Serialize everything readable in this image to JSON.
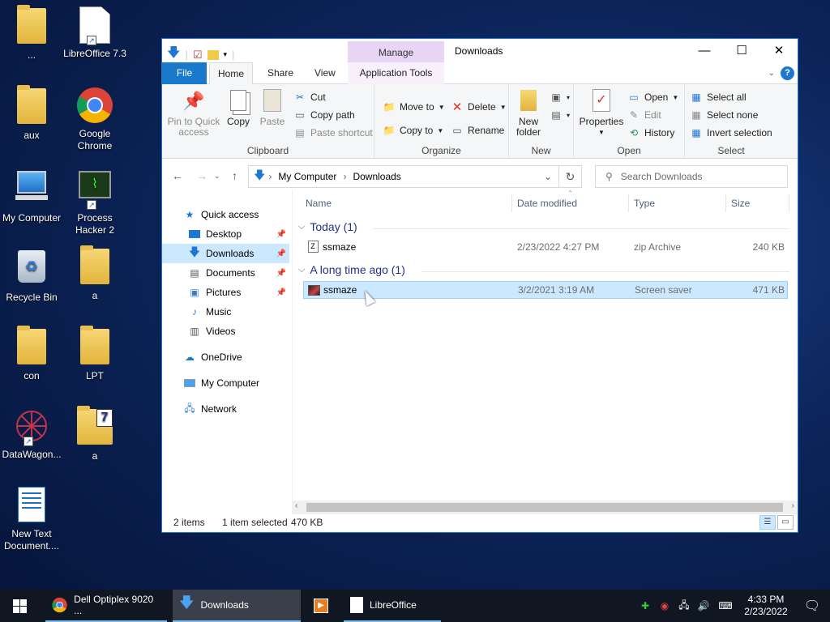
{
  "desktop": {
    "icons": [
      {
        "label": "...",
        "icon": "folder-icon"
      },
      {
        "label": "LibreOffice 7.3",
        "icon": "libreoffice-icon"
      },
      {
        "label": "aux",
        "icon": "folder-icon"
      },
      {
        "label": "Google Chrome",
        "icon": "chrome-icon"
      },
      {
        "label": "My Computer",
        "icon": "computer-icon"
      },
      {
        "label": "Process Hacker 2",
        "icon": "process-hacker-icon"
      },
      {
        "label": "Recycle Bin",
        "icon": "recycle-bin-icon"
      },
      {
        "label": "a",
        "icon": "folder-icon"
      },
      {
        "label": "con",
        "icon": "folder-icon"
      },
      {
        "label": "LPT",
        "icon": "folder-icon"
      },
      {
        "label": "DataWagon...",
        "icon": "datawagon-icon"
      },
      {
        "label": "a",
        "icon": "zip-folder-icon"
      },
      {
        "label": "New Text Document....",
        "icon": "text-document-icon"
      }
    ]
  },
  "window": {
    "title": "Downloads",
    "contextual_tab": "Manage",
    "tabs": {
      "file": "File",
      "home": "Home",
      "share": "Share",
      "view": "View",
      "app_tools": "Application Tools"
    },
    "controls": {
      "minimize": "—",
      "maximize": "☐",
      "close": "✕"
    }
  },
  "ribbon": {
    "clipboard": {
      "label": "Clipboard",
      "pin": "Pin to Quick access",
      "copy": "Copy",
      "paste": "Paste",
      "cut": "Cut",
      "copy_path": "Copy path",
      "paste_shortcut": "Paste shortcut"
    },
    "organize": {
      "label": "Organize",
      "move_to": "Move to",
      "copy_to": "Copy to",
      "delete": "Delete",
      "rename": "Rename"
    },
    "new": {
      "label": "New",
      "new_folder": "New folder"
    },
    "open": {
      "label": "Open",
      "properties": "Properties",
      "open": "Open",
      "edit": "Edit",
      "history": "History"
    },
    "select": {
      "label": "Select",
      "select_all": "Select all",
      "select_none": "Select none",
      "invert": "Invert selection"
    }
  },
  "address": {
    "crumbs": [
      "My Computer",
      "Downloads"
    ],
    "search_placeholder": "Search Downloads"
  },
  "nav": {
    "quick_access": "Quick access",
    "desktop": "Desktop",
    "downloads": "Downloads",
    "documents": "Documents",
    "pictures": "Pictures",
    "music": "Music",
    "videos": "Videos",
    "onedrive": "OneDrive",
    "my_computer": "My Computer",
    "network": "Network"
  },
  "columns": {
    "name": "Name",
    "date": "Date modified",
    "type": "Type",
    "size": "Size"
  },
  "groups": [
    {
      "title": "Today (1)",
      "files": [
        {
          "name": "ssmaze",
          "date": "2/23/2022 4:27 PM",
          "type": "zip Archive",
          "size": "240 KB"
        }
      ]
    },
    {
      "title": "A long time ago (1)",
      "files": [
        {
          "name": "ssmaze",
          "date": "3/2/2021 3:19 AM",
          "type": "Screen saver",
          "size": "471 KB"
        }
      ]
    }
  ],
  "status": {
    "items": "2 items",
    "selected": "1 item selected",
    "size": "470 KB"
  },
  "taskbar": {
    "chrome": "Dell Optiplex 9020 ...",
    "explorer": "Downloads",
    "libreoffice": "LibreOffice",
    "time": "4:33 PM",
    "date": "2/23/2022"
  },
  "colors": {
    "accent": "#1979ca",
    "selection": "#cce8ff",
    "manage": "#e8d5f5",
    "group_header": "#1e3287"
  }
}
